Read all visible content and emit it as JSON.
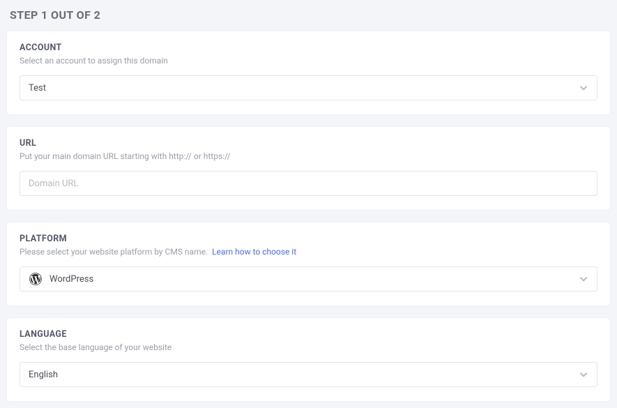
{
  "heading": "STEP 1 OUT OF 2",
  "account": {
    "title": "ACCOUNT",
    "desc": "Select an account to assign this domain",
    "value": "Test"
  },
  "url": {
    "title": "URL",
    "desc": "Put your main domain URL starting with http:// or https://",
    "placeholder": "Domain URL"
  },
  "platform": {
    "title": "PLATFORM",
    "desc_prefix": "Please select your website platform by CMS name.",
    "desc_link": "Learn how to choose it",
    "value": "WordPress"
  },
  "language": {
    "title": "LANGUAGE",
    "desc": "Select the base language of your website",
    "value": "English"
  }
}
